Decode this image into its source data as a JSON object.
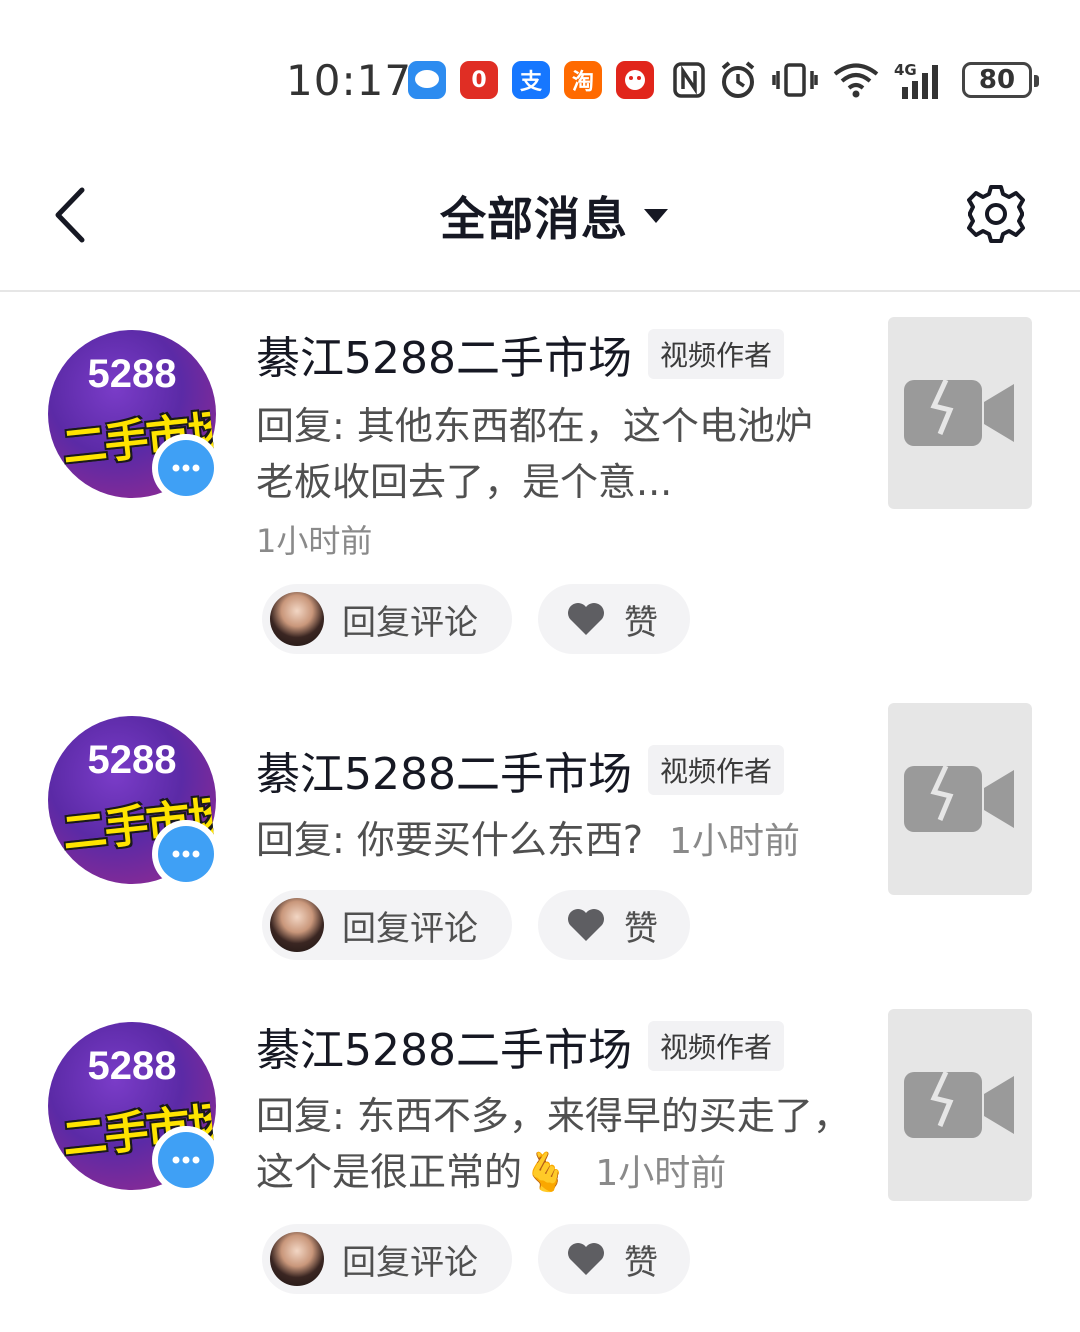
{
  "status_bar": {
    "time": "10:17",
    "apps": [
      {
        "icon": "message-app-icon",
        "color": "#2d8cf0",
        "glyph": "…"
      },
      {
        "icon": "pinduoduo-app-icon",
        "color": "#e02e24",
        "glyph": "0"
      },
      {
        "icon": "alipay-app-icon",
        "color": "#1677ff",
        "glyph": "支"
      },
      {
        "icon": "taobao-app-icon",
        "color": "#ff6a00",
        "glyph": "淘"
      },
      {
        "icon": "jd-app-icon",
        "color": "#e1251b",
        "glyph": "京"
      }
    ],
    "signal_label": "4G",
    "battery": "80"
  },
  "header": {
    "title": "全部消息",
    "back_icon": "chevron-left-icon",
    "settings_icon": "gear-icon"
  },
  "messages": [
    {
      "avatar_text": "5288",
      "avatar_sub": "二手市场",
      "name": "綦江5288二手市场",
      "tag": "视频作者",
      "reply": "回复: 其他东西都在，这个电池炉老板收回去了，是个意...",
      "time": "1小时前",
      "reply_button": "回复评论",
      "like_button": "赞"
    },
    {
      "avatar_text": "5288",
      "avatar_sub": "二手市场",
      "name": "綦江5288二手市场",
      "tag": "视频作者",
      "reply": "回复: 你要买什么东西?",
      "time": "1小时前",
      "reply_button": "回复评论",
      "like_button": "赞"
    },
    {
      "avatar_text": "5288",
      "avatar_sub": "二手市场",
      "name": "綦江5288二手市场",
      "tag": "视频作者",
      "reply": "回复: 东西不多，来得早的买走了，这个是很正常的🫰",
      "time": "1小时前",
      "reply_button": "回复评论",
      "like_button": "赞"
    }
  ],
  "colors": {
    "badge_blue": "#3fa0f5",
    "thumb_gray": "#e6e6e6",
    "pill_bg": "#f3f3f5"
  }
}
